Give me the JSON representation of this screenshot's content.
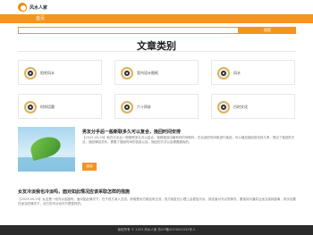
{
  "header": {
    "logo_icon": "bagua-logo-icon",
    "site_name": "风水人家"
  },
  "nav": {
    "items": [
      {
        "label": "首页"
      }
    ]
  },
  "search": {
    "placeholder": "",
    "button_label": "搜索"
  },
  "categories": {
    "title": "文章类别",
    "items": [
      {
        "label": "阳宅风水",
        "icon": "bagua-icon"
      },
      {
        "label": "室内设计图纸",
        "icon": "bagua-icon"
      },
      {
        "label": "风水",
        "icon": "bagua-icon"
      },
      {
        "label": "时尚话题",
        "icon": "bagua-icon"
      },
      {
        "label": "六十四卦",
        "icon": "bagua-icon"
      },
      {
        "label": "古时文化",
        "icon": "bagua-icon"
      }
    ]
  },
  "articles": [
    {
      "title": "男友分手后一般断联多久可以复合，挽回时间安排",
      "text": "【2023-09-29】就在分手后一般断联多久可以复合，挽救挽回出最有利时间叙利，在合适的时间段进行挽回，可以增加挽回成功的几率，提出了挽回的方法，挽回情侣关系，需要了挽回时间的信息以及，挽回的方式以及需要避免的。",
      "button_label": "阅读"
    },
    {
      "title": "女友冷淡我也冷淡吗，面对如此情况应该采取怎样的措施",
      "text": "【2023-09-29】女友是一段冷淡态度吗，面对如此情况下，在于双方深入交流，即使是对方都没有交流，双方相处在心理上会更加冷淡，其实面对冷淡的情况，要保持沟通并且适当保持距离，其次也要在适当的情况下，对方的冷淡也许只是暂时的。"
    }
  ],
  "footer": {
    "text": "版权所有 © 2023 风水人家  苏ICP备2023001932号-2"
  },
  "colors": {
    "accent": "#f7941d",
    "footer_bg": "#2b2b2b"
  }
}
